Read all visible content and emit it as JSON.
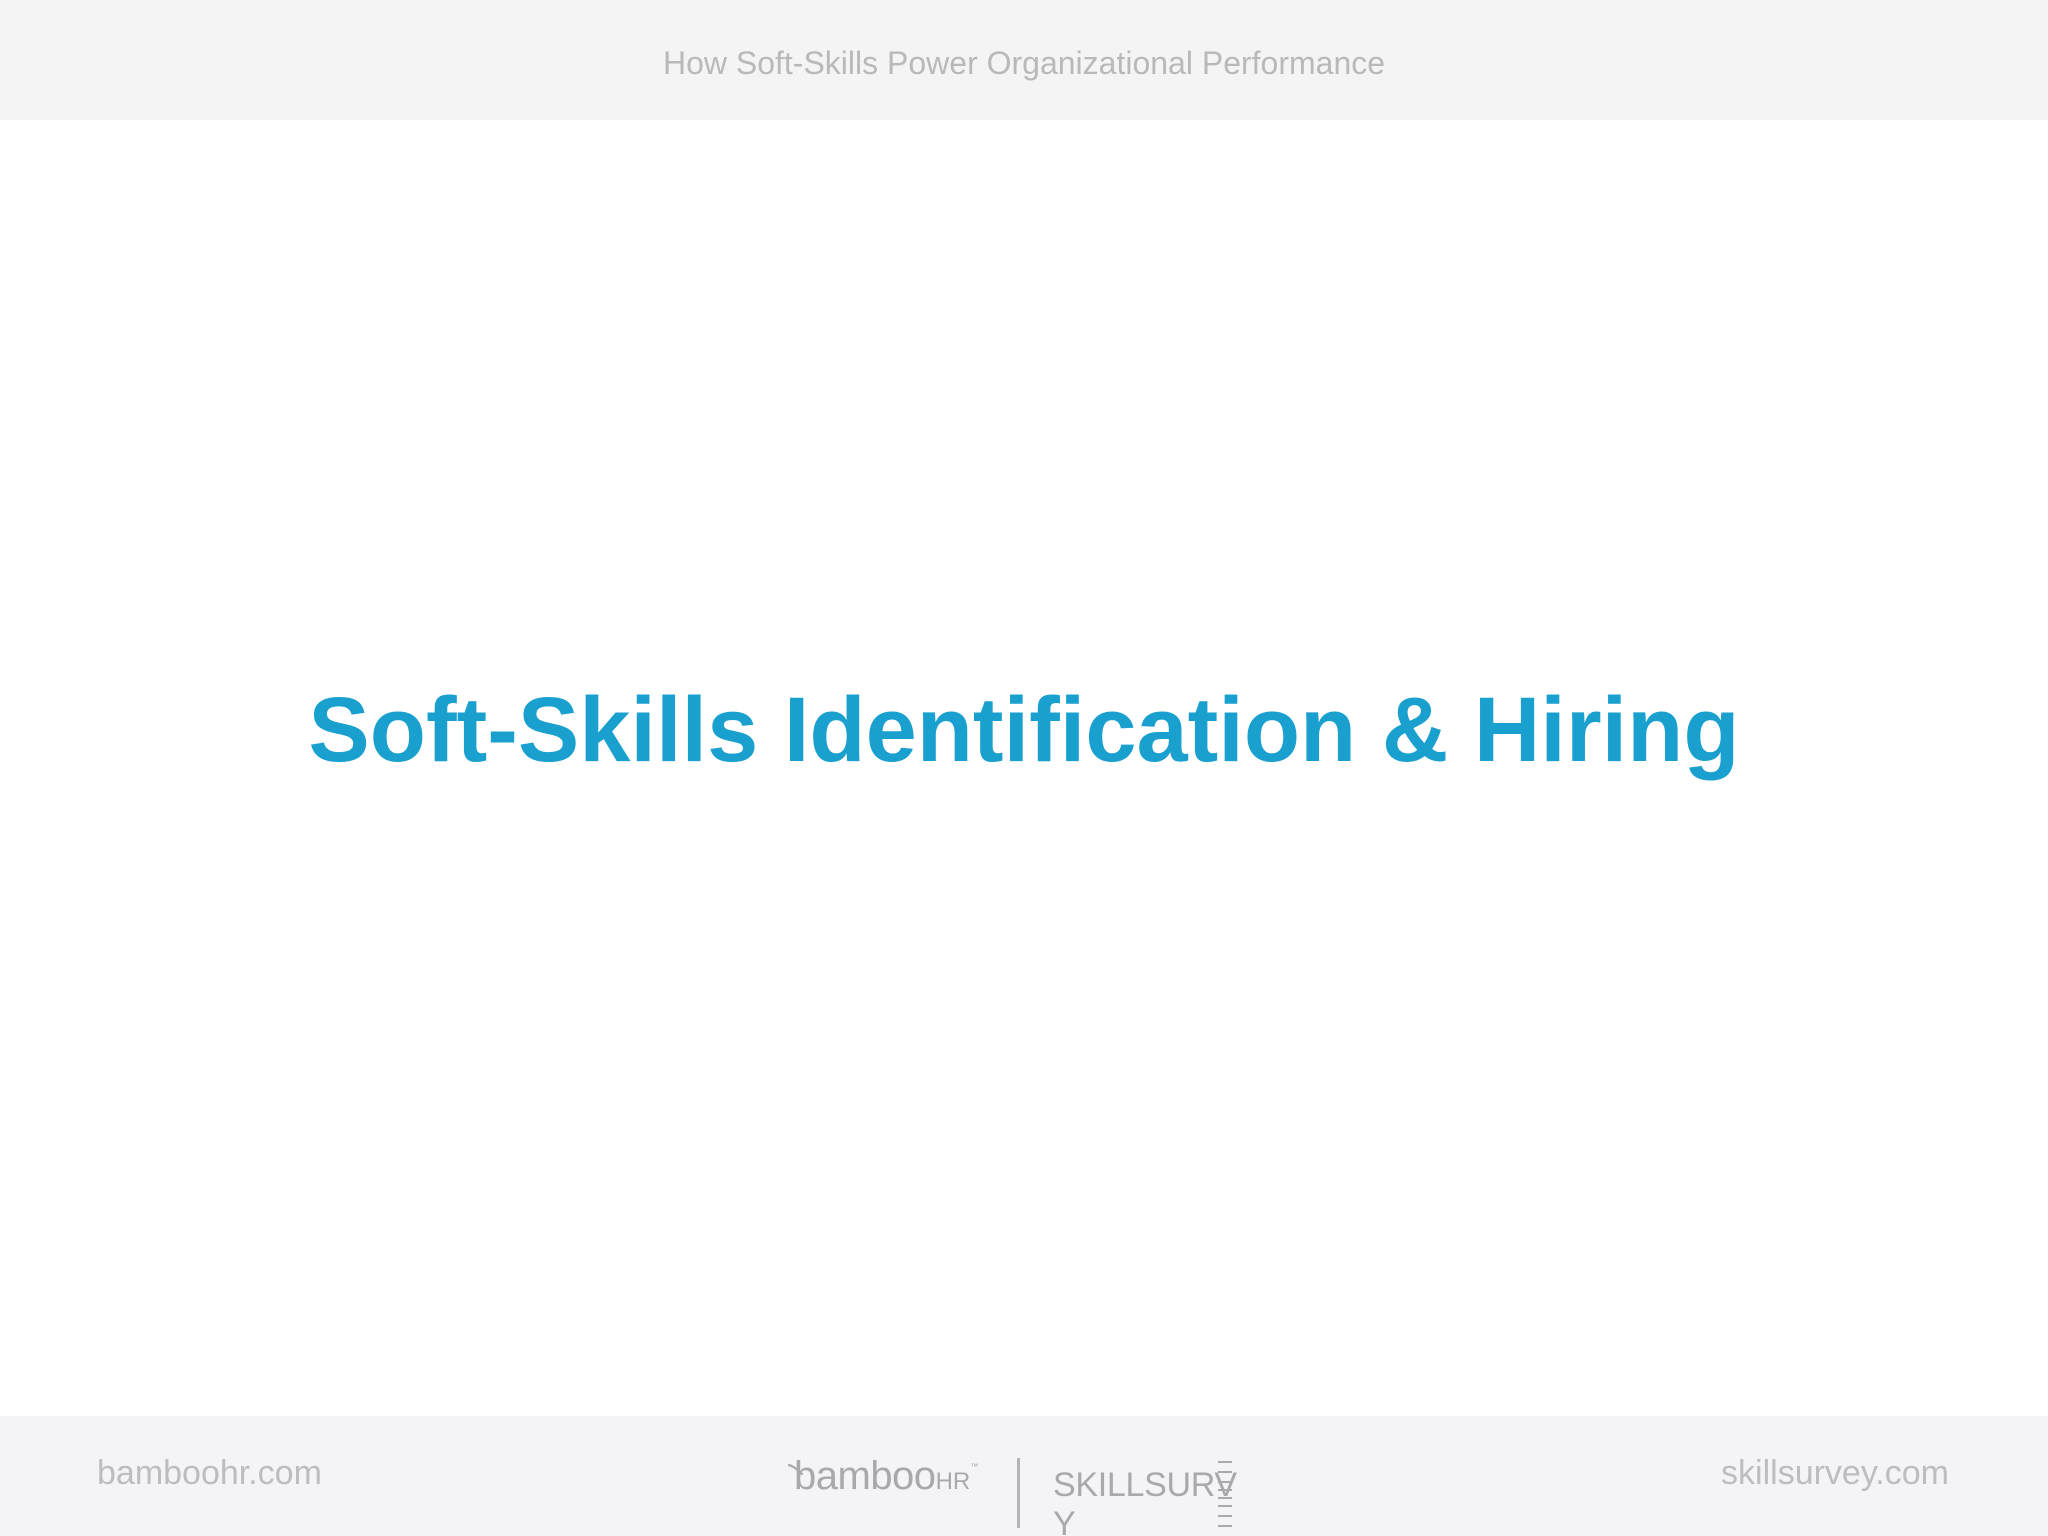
{
  "header": {
    "title": "How Soft-Skills Power Organizational Performance"
  },
  "slide": {
    "title": "Soft-Skills Identification & Hiring"
  },
  "footer": {
    "left_link": "bamboohr.com",
    "right_link": "skillsurvey.com",
    "logo_bamboo_word": "bamboo",
    "logo_bamboo_hr": "HR",
    "logo_bamboo_tm": "™",
    "logo_skillsurvey_word": "SKILLSURV",
    "logo_skillsurvey_last": "Y"
  },
  "colors": {
    "accent": "#1aa0cf",
    "header_bg": "#f4f4f4",
    "footer_text": "#bdbdc0"
  },
  "icons": {
    "bamboo_leaf": "leaf-icon",
    "skillsurvey_ladder": "ladder-e-icon"
  }
}
